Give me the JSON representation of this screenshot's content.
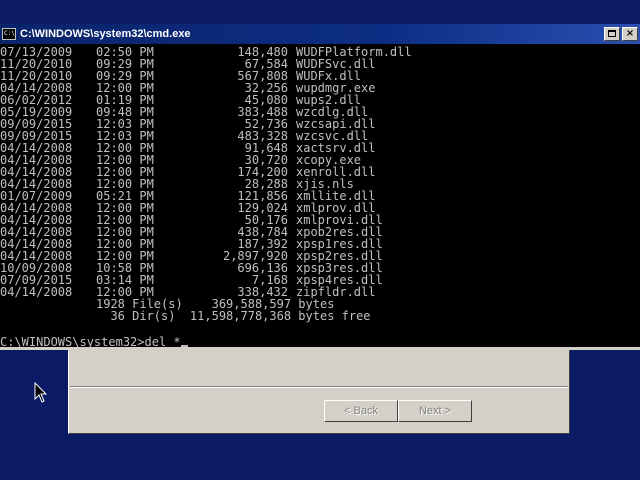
{
  "window": {
    "title": "C:\\WINDOWS\\system32\\cmd.exe",
    "icon": "cmd-icon",
    "icon_glyph": "C:\\"
  },
  "listing": [
    {
      "date": "07/13/2009",
      "time": "02:50 PM",
      "size": "148,480",
      "name": "WUDFPlatform.dll"
    },
    {
      "date": "11/20/2010",
      "time": "09:29 PM",
      "size": "67,584",
      "name": "WUDFSvc.dll"
    },
    {
      "date": "11/20/2010",
      "time": "09:29 PM",
      "size": "567,808",
      "name": "WUDFx.dll"
    },
    {
      "date": "04/14/2008",
      "time": "12:00 PM",
      "size": "32,256",
      "name": "wupdmgr.exe"
    },
    {
      "date": "06/02/2012",
      "time": "01:19 PM",
      "size": "45,080",
      "name": "wups2.dll"
    },
    {
      "date": "05/19/2009",
      "time": "09:48 PM",
      "size": "383,488",
      "name": "wzcdlg.dll"
    },
    {
      "date": "09/09/2015",
      "time": "12:03 PM",
      "size": "52,736",
      "name": "wzcsapi.dll"
    },
    {
      "date": "09/09/2015",
      "time": "12:03 PM",
      "size": "483,328",
      "name": "wzcsvc.dll"
    },
    {
      "date": "04/14/2008",
      "time": "12:00 PM",
      "size": "91,648",
      "name": "xactsrv.dll"
    },
    {
      "date": "04/14/2008",
      "time": "12:00 PM",
      "size": "30,720",
      "name": "xcopy.exe"
    },
    {
      "date": "04/14/2008",
      "time": "12:00 PM",
      "size": "174,200",
      "name": "xenroll.dll"
    },
    {
      "date": "04/14/2008",
      "time": "12:00 PM",
      "size": "28,288",
      "name": "xjis.nls"
    },
    {
      "date": "01/07/2009",
      "time": "05:21 PM",
      "size": "121,856",
      "name": "xmllite.dll"
    },
    {
      "date": "04/14/2008",
      "time": "12:00 PM",
      "size": "129,024",
      "name": "xmlprov.dll"
    },
    {
      "date": "04/14/2008",
      "time": "12:00 PM",
      "size": "50,176",
      "name": "xmlprovi.dll"
    },
    {
      "date": "04/14/2008",
      "time": "12:00 PM",
      "size": "438,784",
      "name": "xpob2res.dll"
    },
    {
      "date": "04/14/2008",
      "time": "12:00 PM",
      "size": "187,392",
      "name": "xpsp1res.dll"
    },
    {
      "date": "04/14/2008",
      "time": "12:00 PM",
      "size": "2,897,920",
      "name": "xpsp2res.dll"
    },
    {
      "date": "10/09/2008",
      "time": "10:58 PM",
      "size": "696,136",
      "name": "xpsp3res.dll"
    },
    {
      "date": "07/09/2015",
      "time": "03:14 PM",
      "size": "7,168",
      "name": "xpsp4res.dll"
    },
    {
      "date": "04/14/2008",
      "time": "12:00 PM",
      "size": "338,432",
      "name": "zipfldr.dll"
    }
  ],
  "summary": {
    "files_line": "1928 File(s)    369,588,597 bytes",
    "dirs_line": "  36 Dir(s)  11,598,778,368 bytes free"
  },
  "prompt": {
    "path": "C:\\WINDOWS\\system32>",
    "command": "del *"
  },
  "wizard": {
    "back_label": "< Back",
    "next_label": "Next >"
  }
}
